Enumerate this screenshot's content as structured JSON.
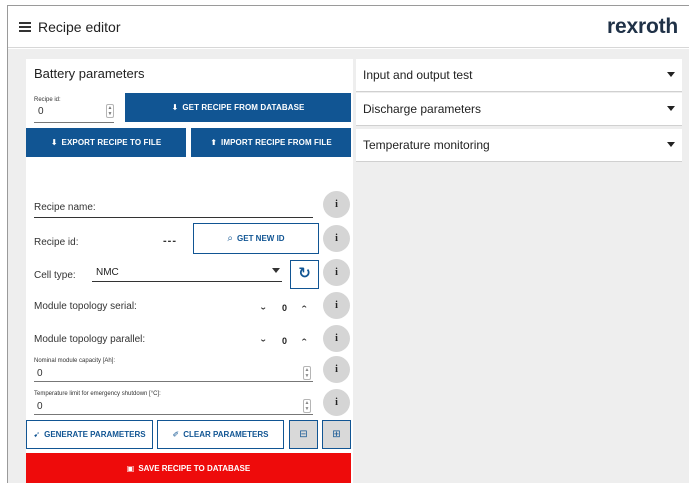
{
  "header": {
    "title": "Recipe editor",
    "brand": "rexroth"
  },
  "battery_parameters": {
    "title": "Battery parameters",
    "recipe_id_small": {
      "label": "Recipe id:",
      "value": "0"
    },
    "get_recipe_button": "GET RECIPE FROM DATABASE",
    "export_button": "EXPORT RECIPE TO FILE",
    "import_button": "IMPORT RECIPE FROM FILE",
    "recipe_name_label": "Recipe name:",
    "recipe_id": {
      "label": "Recipe id:",
      "value": "---"
    },
    "get_new_id_button": "GET NEW ID",
    "cell_type": {
      "label": "Cell type:",
      "value": "NMC"
    },
    "module_topology_serial": {
      "label": "Module topology serial:",
      "value": "0"
    },
    "module_topology_parallel": {
      "label": "Module topology parallel:",
      "value": "0"
    },
    "nominal_capacity": {
      "label": "Nominal module capacity [Ah]:",
      "value": "0"
    },
    "temperature_limit": {
      "label": "Temperature limit for emergency shutdown [°C]:",
      "value": "0"
    },
    "generate_button": "GENERATE PARAMETERS",
    "clear_button": "CLEAR PARAMETERS",
    "save_button": "SAVE RECIPE TO DATABASE",
    "info_symbol": "i"
  },
  "accordions": [
    {
      "label": "Input and output test"
    },
    {
      "label": "Discharge parameters"
    },
    {
      "label": "Temperature monitoring"
    }
  ],
  "colors": {
    "primary_blue": "#115593",
    "danger_red": "#ee0b0b",
    "brand": "#1f3147",
    "background": "#eeeeee"
  }
}
